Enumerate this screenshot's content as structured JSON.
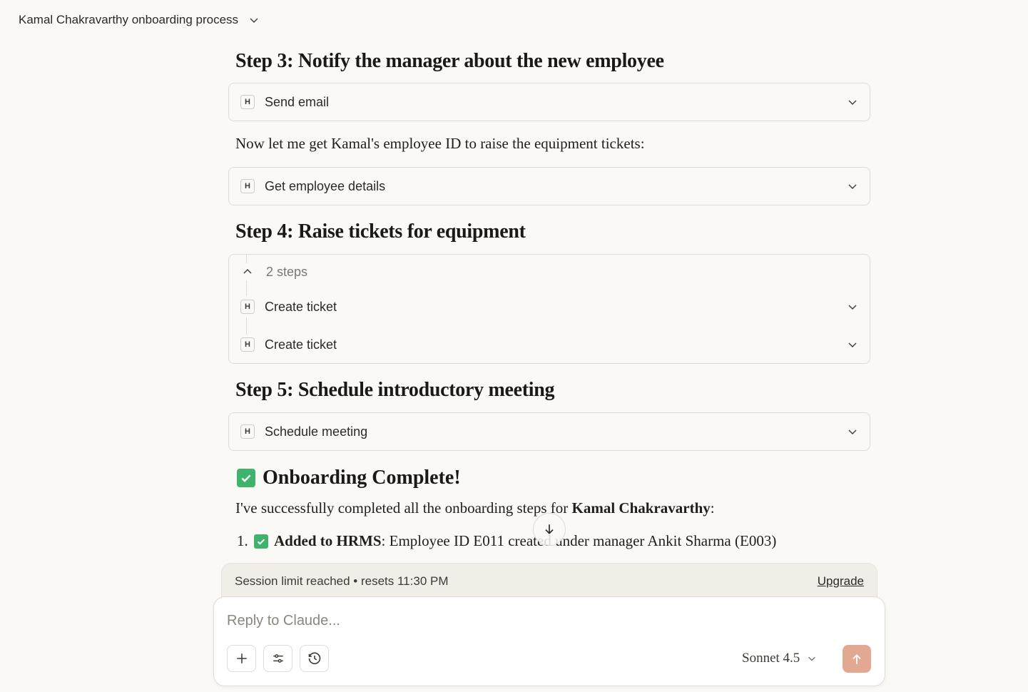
{
  "header": {
    "title": "Kamal Chakravarthy onboarding process"
  },
  "steps": {
    "step3_heading": "Step 3: Notify the manager about the new employee",
    "step3_tool": "Send email",
    "interlude": "Now let me get Kamal's employee ID to raise the equipment tickets:",
    "employee_tool": "Get employee details",
    "step4_heading": "Step 4: Raise tickets for equipment",
    "step4_group_count": "2 steps",
    "step4_tool_1": "Create ticket",
    "step4_tool_2": "Create ticket",
    "step5_heading": "Step 5: Schedule introductory meeting",
    "step5_tool": "Schedule meeting",
    "tool_badge": "H"
  },
  "completion": {
    "title": "Onboarding Complete!",
    "intro_prefix": "I've successfully completed all the onboarding steps for ",
    "intro_name": "Kamal Chakravarthy",
    "intro_suffix": ":",
    "items": [
      {
        "number": "1.",
        "bold": "Added to HRMS",
        "text": ": Employee ID E011 created under manager Ankit Sharma (E003)"
      }
    ]
  },
  "banner": {
    "message": "Session limit reached • resets 11:30 PM",
    "upgrade_label": "Upgrade"
  },
  "composer": {
    "placeholder": "Reply to Claude...",
    "model_label": "Sonnet 4.5"
  },
  "colors": {
    "background": "#faf9f5",
    "send_button": "#e3a892",
    "check_green": "#3fb36b",
    "banner_bg": "#f0eee6"
  },
  "icons": [
    "chevron-down-icon",
    "chevron-up-icon",
    "check-box-icon",
    "arrow-down-icon",
    "plus-icon",
    "sliders-icon",
    "clock-icon",
    "arrow-up-icon"
  ]
}
